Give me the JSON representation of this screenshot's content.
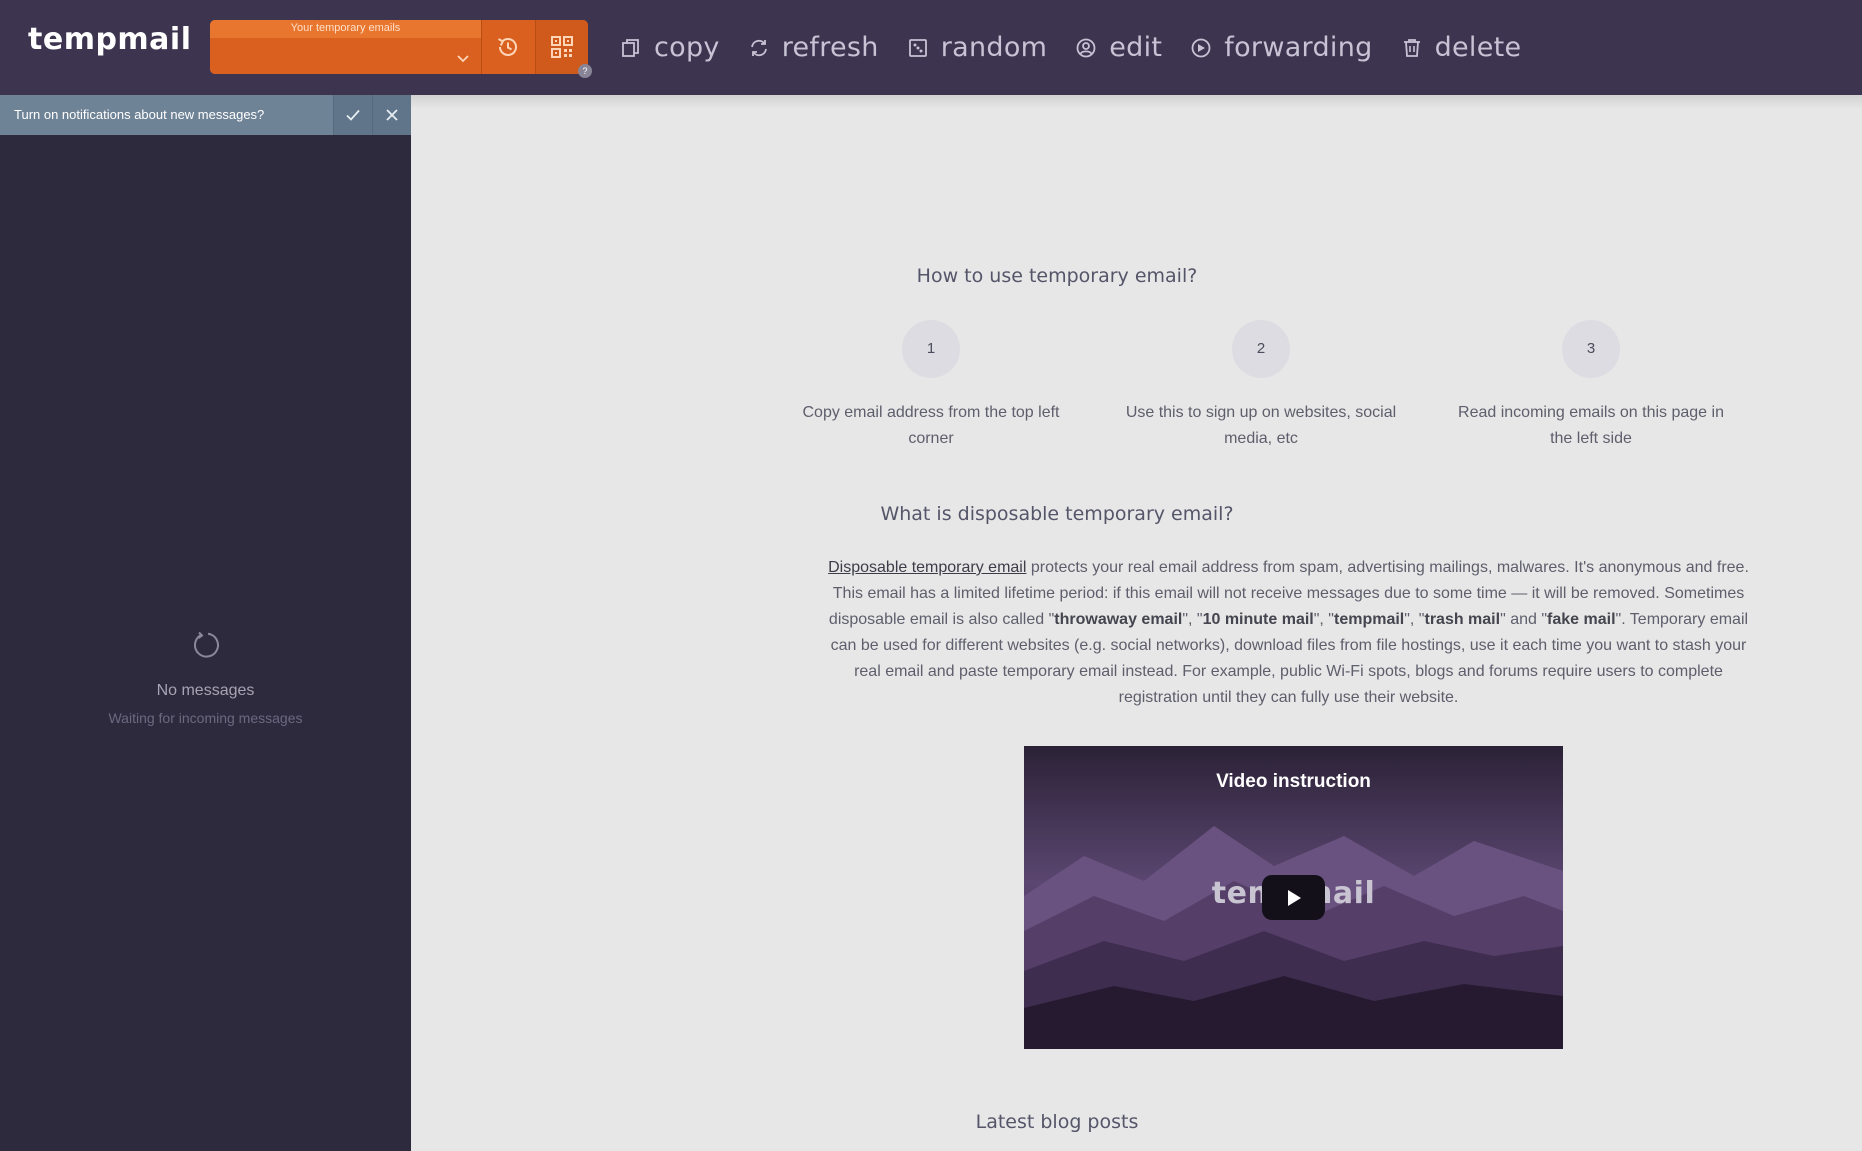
{
  "header": {
    "logo": "tempmail",
    "email_label": "Your temporary emails",
    "email_value": "",
    "qr_help": "?",
    "actions": [
      {
        "label": "copy",
        "icon": "copy-icon"
      },
      {
        "label": "refresh",
        "icon": "refresh-icon"
      },
      {
        "label": "random",
        "icon": "dice-icon"
      },
      {
        "label": "edit",
        "icon": "user-edit-icon"
      },
      {
        "label": "forwarding",
        "icon": "forward-icon"
      },
      {
        "label": "delete",
        "icon": "trash-icon"
      }
    ]
  },
  "notification": {
    "text": "Turn on notifications about new messages?"
  },
  "inbox": {
    "title": "No messages",
    "subtitle": "Waiting for incoming messages"
  },
  "howto": {
    "title": "How to use temporary email?",
    "steps": [
      {
        "number": "1",
        "text": "Copy email address from the top left corner"
      },
      {
        "number": "2",
        "text": "Use this to sign up on websites, social media, etc"
      },
      {
        "number": "3",
        "text": "Read incoming emails on this page in the left side"
      }
    ]
  },
  "about": {
    "title": "What is disposable temporary email?",
    "link_text": "Disposable temporary email",
    "p1": " protects your real email address from spam, advertising mailings, malwares. It's anonymous and free. This email has a limited lifetime period: if this email will not receive messages due to some time — it will be removed. Sometimes disposable email is also called \"",
    "k1": "throwaway email",
    "s1": "\", \"",
    "k2": "10 minute mail",
    "s2": "\", \"",
    "k3": "tempmail",
    "s3": "\", \"",
    "k4": "trash mail",
    "s4": "\" and \"",
    "k5": "fake mail",
    "p2": "\". Temporary email can be used for different websites (e.g. social networks), download files from file hostings, use it each time you want to stash your real email and paste temporary email instead. For example, public Wi-Fi spots, blogs and forums require users to complete registration until they can fully use their website."
  },
  "video": {
    "title": "Video instruction",
    "logo": "tempmail"
  },
  "blog": {
    "title": "Latest blog posts"
  },
  "colors": {
    "topbar": "#3d3450",
    "accent": "#d9601e",
    "sidebar": "#2e2a3d",
    "notify": "#6f8396",
    "main_bg": "#e7e7e7"
  }
}
